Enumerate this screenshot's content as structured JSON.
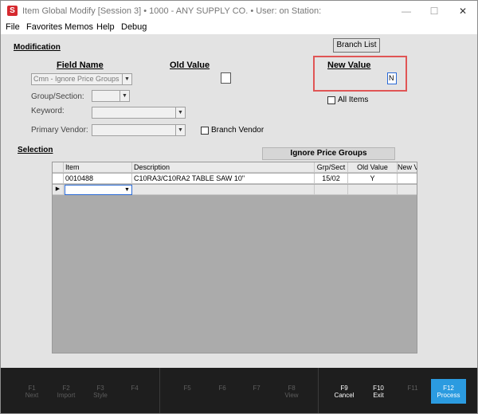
{
  "window": {
    "title": "Item Global Modify [Session 3]  •  1000 - ANY SUPPLY CO.  •  User:                 on Station:",
    "app_icon_letter": "S",
    "minimize": "—",
    "maximize": "☐",
    "close": "✕"
  },
  "menu": [
    "File",
    "Favorites",
    "Memos",
    "Help",
    "Debug"
  ],
  "modification": {
    "section_label": "Modification",
    "field_name_header": "Field Name",
    "old_value_header": "Old Value",
    "new_value_header": "New Value",
    "field_name_value": "Cmn - Ignore Price Groups",
    "group_section_label": "Group/Section:",
    "keyword_label": "Keyword:",
    "primary_vendor_label": "Primary Vendor:",
    "branch_vendor_label": "Branch Vendor",
    "branch_list_button": "Branch List",
    "new_value_input": "N",
    "all_items_label": "All Items"
  },
  "selection": {
    "section_label": "Selection",
    "group_header": "Ignore Price Groups",
    "columns": [
      "Item",
      "Description",
      "Grp/Sect",
      "Old Value",
      "New Value"
    ],
    "rows": [
      {
        "item": "0010488",
        "description": "C10RA3/C10RA2 TABLE SAW 10\"",
        "grp_sect": "15/02",
        "old_value": "Y",
        "new_value": ""
      }
    ],
    "new_row_pointer": "▶"
  },
  "fkeys": [
    {
      "key": "F1",
      "label": "Next",
      "state": "disabled"
    },
    {
      "key": "F2",
      "label": "Import",
      "state": "disabled"
    },
    {
      "key": "F3",
      "label": "Style",
      "state": "disabled"
    },
    {
      "key": "F4",
      "label": "",
      "state": "disabled"
    },
    {
      "key": "F5",
      "label": "",
      "state": "disabled"
    },
    {
      "key": "F6",
      "label": "",
      "state": "disabled"
    },
    {
      "key": "F7",
      "label": "",
      "state": "disabled"
    },
    {
      "key": "F8",
      "label": "View",
      "state": "disabled"
    },
    {
      "key": "F9",
      "label": "Cancel",
      "state": "active"
    },
    {
      "key": "F10",
      "label": "Exit",
      "state": "active"
    },
    {
      "key": "F11",
      "label": "",
      "state": "disabled"
    },
    {
      "key": "F12",
      "label": "Process",
      "state": "primary"
    }
  ],
  "colors": {
    "accent_blue": "#2b9be0",
    "highlight_red": "#e05555",
    "app_icon_red": "#d6292f",
    "fkey_bar": "#1e1e1e"
  }
}
